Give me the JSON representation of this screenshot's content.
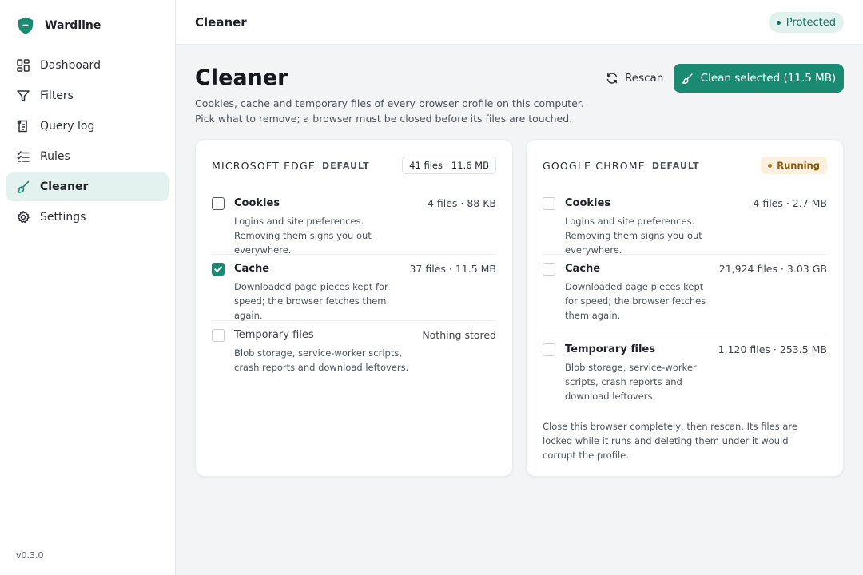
{
  "app": {
    "name": "Wardline",
    "version": "v0.3.0"
  },
  "sidebar": {
    "items": [
      {
        "label": "Dashboard",
        "icon": "dashboard-icon"
      },
      {
        "label": "Filters",
        "icon": "filter-icon"
      },
      {
        "label": "Query log",
        "icon": "log-icon"
      },
      {
        "label": "Rules",
        "icon": "rules-icon"
      },
      {
        "label": "Cleaner",
        "icon": "brush-icon",
        "active": true
      },
      {
        "label": "Settings",
        "icon": "gear-icon"
      }
    ]
  },
  "topbar": {
    "title": "Cleaner",
    "status": "Protected"
  },
  "page": {
    "title": "Cleaner",
    "description_line1": "Cookies, cache and temporary files of every browser profile on this computer.",
    "description_line2": "Pick what to remove; a browser must be closed before its files are touched.",
    "rescan_label": "Rescan",
    "clean_label": "Clean selected (11.5 MB)"
  },
  "colors": {
    "accent": "#1a8a72",
    "running": "#b7791f"
  },
  "browsers": [
    {
      "name": "MICROSOFT EDGE",
      "tag": "DEFAULT",
      "total": "41 files · 11.6 MB",
      "items": [
        {
          "title": "Cookies",
          "size": "4 files · 88 KB",
          "desc": "Logins and site preferences. Removing them signs you out everywhere.",
          "checked": false
        },
        {
          "title": "Cache",
          "size": "37 files · 11.5 MB",
          "desc": "Downloaded page pieces kept for speed; the browser fetches them again.",
          "checked": true
        },
        {
          "title": "Temporary files",
          "size": "Nothing stored",
          "desc": "Blob storage, service-worker scripts, crash reports and download leftovers.",
          "checked": false,
          "disabled": true
        }
      ]
    },
    {
      "name": "GOOGLE CHROME",
      "tag": "DEFAULT",
      "status": "Running",
      "items": [
        {
          "title": "Cookies",
          "size": "4 files · 2.7 MB",
          "desc": "Logins and site preferences. Removing them signs you out everywhere.",
          "checked": false,
          "disabled": true
        },
        {
          "title": "Cache",
          "size": "21,924 files · 3.03 GB",
          "desc": "Downloaded page pieces kept for speed; the browser fetches them again.",
          "checked": false,
          "disabled": true
        },
        {
          "title": "Temporary files",
          "size": "1,120 files · 253.5 MB",
          "desc": "Blob storage, service-worker scripts, crash reports and download leftovers.",
          "checked": false,
          "disabled": true
        }
      ],
      "note": "Close this browser completely, then rescan. Its files are locked while it runs and deleting them under it would corrupt the profile."
    }
  ]
}
